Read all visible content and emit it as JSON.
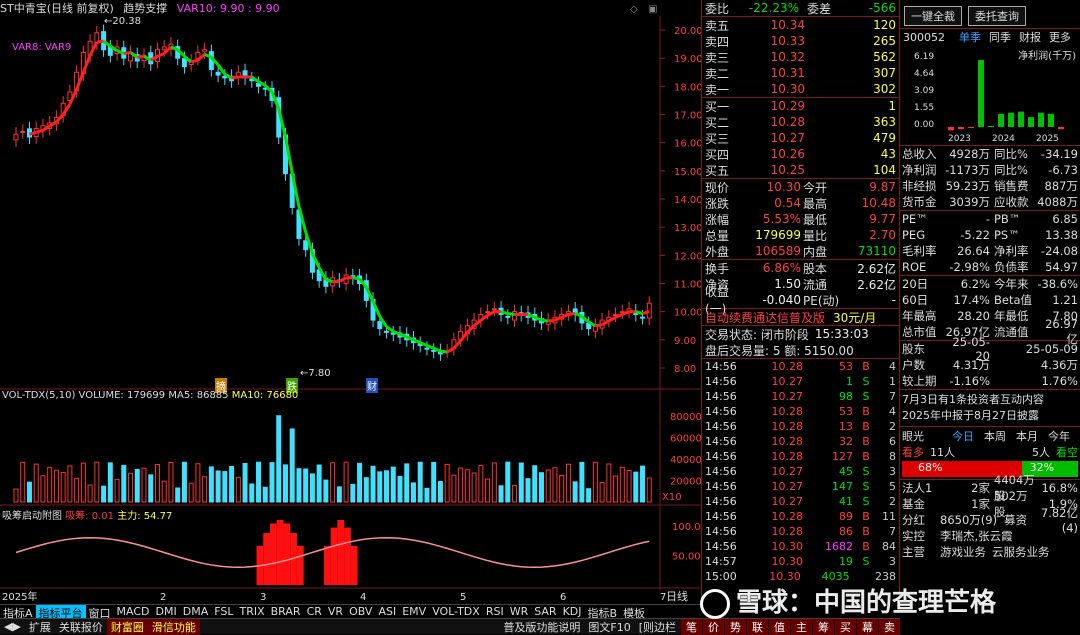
{
  "chart_header": {
    "stock": "ST中青宝(日线 前复权)",
    "indicator": "趋势支撑",
    "var10": "VAR10: 9.90 : 9.90"
  },
  "price_axis": [
    "20.00",
    "19.00",
    "18.00",
    "17.00",
    "16.00",
    "15.00",
    "14.00",
    "13.00",
    "12.00",
    "11.00",
    "10.00",
    "9.00",
    "8.00"
  ],
  "price_labels": {
    "high": "20.38",
    "low": "7.80",
    "var8": "VAR8: VAR9"
  },
  "markers": [
    "摘",
    "跌",
    "财"
  ],
  "vol_header": {
    "label": "VOL-TDX(5,10)",
    "volume": "VOLUME: 179699",
    "ma5": "MA5: 86885",
    "ma10": "MA10: 76680"
  },
  "vol_axis": [
    "80000",
    "60000",
    "40000",
    "20000",
    "X10"
  ],
  "chip_header": {
    "label": "吸筹启动附图",
    "xichou": "吸筹: 0.01",
    "zhuli": "主力: 54.77"
  },
  "chip_axis": [
    "100.00",
    "50.00"
  ],
  "x_axis": [
    "2025年",
    "2",
    "3",
    "4",
    "5",
    "6",
    "7"
  ],
  "bottom_tabs": [
    "指标A",
    "指标平台",
    "窗口",
    "MACD",
    "DMI",
    "DMA",
    "FSL",
    "TRIX",
    "BRAR",
    "CR",
    "VR",
    "OBV",
    "ASI",
    "EMV",
    "VOL-TDX",
    "RSI",
    "WR",
    "SAR",
    "KDJ",
    "指标B",
    "模板"
  ],
  "right_tab": "日线",
  "status_bar": [
    "扩展",
    "关联报价",
    "财富圈",
    "滑信功能",
    "普及版功能说明",
    "图文F10",
    "[则边栏"
  ],
  "status_icons": [
    "笔",
    "价",
    "势",
    "联",
    "值",
    "主",
    "筹",
    "买",
    "幕",
    "卖"
  ],
  "quote": {
    "weibi_label": "委比",
    "weibi": "-22.23%",
    "weicha_label": "委差",
    "weicha": "-566",
    "asks": [
      {
        "label": "卖五",
        "price": "10.34",
        "vol": "120"
      },
      {
        "label": "卖四",
        "price": "10.33",
        "vol": "265"
      },
      {
        "label": "卖三",
        "price": "10.32",
        "vol": "562"
      },
      {
        "label": "卖二",
        "price": "10.31",
        "vol": "307"
      },
      {
        "label": "卖一",
        "price": "10.30",
        "vol": "302"
      }
    ],
    "bids": [
      {
        "label": "买一",
        "price": "10.29",
        "vol": "1"
      },
      {
        "label": "买二",
        "price": "10.28",
        "vol": "363"
      },
      {
        "label": "买三",
        "price": "10.27",
        "vol": "479"
      },
      {
        "label": "买四",
        "price": "10.26",
        "vol": "43"
      },
      {
        "label": "买五",
        "price": "10.25",
        "vol": "104"
      }
    ],
    "stats": [
      {
        "l1": "现价",
        "v1": "10.30",
        "l2": "今开",
        "v2": "9.87"
      },
      {
        "l1": "涨跌",
        "v1": "0.54",
        "l2": "最高",
        "v2": "10.48"
      },
      {
        "l1": "涨幅",
        "v1": "5.53%",
        "l2": "最低",
        "v2": "9.77"
      },
      {
        "l1": "总量",
        "v1": "179699",
        "l2": "量比",
        "v2": "2.70"
      },
      {
        "l1": "外盘",
        "v1": "106589",
        "l2": "内盘",
        "v2": "73110"
      }
    ],
    "stats2": [
      {
        "l1": "换手",
        "v1": "6.86%",
        "l2": "股本",
        "v2": "2.62亿"
      },
      {
        "l1": "净资",
        "v1": "1.50",
        "l2": "流通",
        "v2": "2.62亿"
      },
      {
        "l1": "收益(一)",
        "v1": "-0.040",
        "l2": "PE(动)",
        "v2": "-"
      }
    ],
    "promo": "自动续费通达信普及版",
    "promo_price": "30元/月",
    "trade_status": "交易状态: 闭市阶段",
    "trade_time": "15:33:03",
    "after_hours": "盘后交易量: 5  额: 5150.00",
    "trades": [
      {
        "t": "14:56",
        "p": "10.28",
        "v": "53",
        "d": "B",
        "n": "4"
      },
      {
        "t": "14:56",
        "p": "10.27",
        "v": "1",
        "d": "S",
        "n": "1"
      },
      {
        "t": "14:56",
        "p": "10.27",
        "v": "98",
        "d": "S",
        "n": "7"
      },
      {
        "t": "14:56",
        "p": "10.28",
        "v": "53",
        "d": "B",
        "n": "4"
      },
      {
        "t": "14:56",
        "p": "10.28",
        "v": "13",
        "d": "B",
        "n": "2"
      },
      {
        "t": "14:56",
        "p": "10.28",
        "v": "32",
        "d": "B",
        "n": "6"
      },
      {
        "t": "14:56",
        "p": "10.28",
        "v": "127",
        "d": "B",
        "n": "8"
      },
      {
        "t": "14:56",
        "p": "10.27",
        "v": "45",
        "d": "S",
        "n": "3"
      },
      {
        "t": "14:56",
        "p": "10.27",
        "v": "147",
        "d": "S",
        "n": "5"
      },
      {
        "t": "14:56",
        "p": "10.27",
        "v": "41",
        "d": "S",
        "n": "2"
      },
      {
        "t": "14:56",
        "p": "10.28",
        "v": "89",
        "d": "B",
        "n": "11"
      },
      {
        "t": "14:56",
        "p": "10.28",
        "v": "86",
        "d": "B",
        "n": "7"
      },
      {
        "t": "14:56",
        "p": "10.30",
        "v": "1682",
        "d": "B",
        "n": "84"
      },
      {
        "t": "14:57",
        "p": "10.30",
        "v": "19",
        "d": "S",
        "n": "3"
      },
      {
        "t": "15:00",
        "p": "10.30",
        "v": "4035",
        "d": "",
        "n": "238"
      }
    ]
  },
  "right": {
    "buttons": [
      "一键全裁",
      "委托查询"
    ],
    "code": "300052",
    "tabs": [
      "单季",
      "同季",
      "财报",
      "更多"
    ],
    "profit_title": "净利润(千万)",
    "profit_axis": [
      "6.19",
      "4.64",
      "3.09",
      "1.55",
      "0.00"
    ],
    "profit_years": [
      "2023",
      "2024",
      "2025"
    ],
    "fin": [
      {
        "a": "总收入",
        "b": "4928万",
        "c": "同比%",
        "d": "-34.19"
      },
      {
        "a": "净利润",
        "b": "-1173万",
        "c": "同比%",
        "d": "-6.73"
      },
      {
        "a": "非经损",
        "b": "59.23万",
        "c": "销售费",
        "d": "887万"
      },
      {
        "a": "货币金",
        "b": "3039万",
        "c": "应收款",
        "d": "4088万"
      }
    ],
    "val": [
      {
        "a": "PE™",
        "b": "-",
        "c": "PB™",
        "d": "6.85"
      },
      {
        "a": "PEG",
        "b": "-5.22",
        "c": "PS™",
        "d": "13.38"
      },
      {
        "a": "毛利率",
        "b": "26.64",
        "c": "净利率",
        "d": "-24.08"
      },
      {
        "a": "ROE",
        "b": "-2.98%",
        "c": "负债率",
        "d": "54.97"
      }
    ],
    "perf": [
      {
        "a": "20日",
        "b": "6.2%",
        "c": "今年来",
        "d": "-38.6%"
      },
      {
        "a": "60日",
        "b": "17.4%",
        "c": "Beta值",
        "d": "1.21"
      },
      {
        "a": "年最高",
        "b": "28.20",
        "c": "年最低",
        "d": "7.80"
      },
      {
        "a": "总市值",
        "b": "26.97亿",
        "c": "流通值",
        "d": "26.97亿"
      }
    ],
    "holders": [
      {
        "a": "股东",
        "b": "25-05-20",
        "c": "25-05-09"
      },
      {
        "a": "户数",
        "b": "4.31万",
        "c": "4.36万"
      },
      {
        "a": "较上期",
        "b": "-1.16%",
        "c": "1.76%"
      }
    ],
    "news": [
      "7月3日有1条投资者互动内容",
      "2025年中报于8月27日披露"
    ],
    "eye": {
      "label": "眼光",
      "tabs": [
        "今日",
        "本周",
        "本月",
        "今年"
      ],
      "bull": "看多",
      "bull_n": "11人",
      "bear_n": "5人",
      "bear": "看空",
      "bull_pct": "68%",
      "bear_pct": "32%"
    },
    "inst": [
      {
        "a": "法人1",
        "b": "2家",
        "c": "4404万股",
        "d": "16.8%"
      },
      {
        "a": "基金",
        "b": "1家",
        "c": "502万股",
        "d": "1.9%"
      }
    ],
    "fenhong": {
      "a": "分红",
      "b": "8650万(9)",
      "c": "募资",
      "d": "7.82亿(4)"
    },
    "extra": [
      "实控",
      "李瑞杰,张云霞",
      "主营",
      "游戏业务",
      "云服务业务"
    ]
  },
  "watermark": "雪球：中国的查理芒格",
  "colors": {
    "up": "#ff3232",
    "down": "#40e0ff",
    "ma": "#ffffff",
    "trend_up": "#ff2020",
    "trend_down": "#00e000"
  }
}
